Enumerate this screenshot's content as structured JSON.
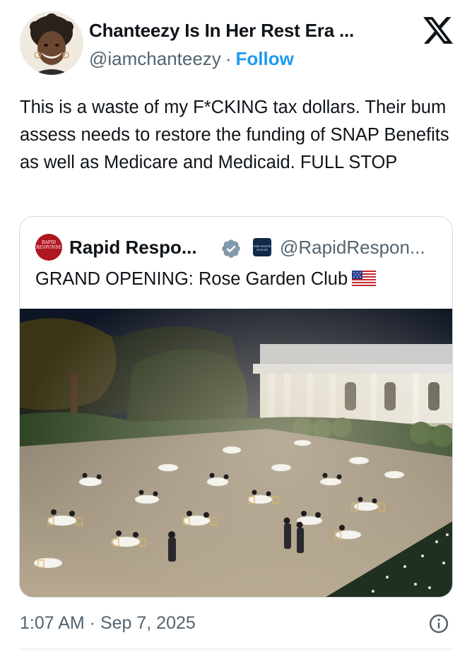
{
  "author": {
    "name": "Chanteezy Is In Her Rest Era ...",
    "handle": "@iamchanteezy",
    "separator": "·",
    "follow_label": "Follow",
    "avatar_icon": "user-avatar-photo"
  },
  "brand_icon": "x-logo-icon",
  "tweet": {
    "text": "This is a waste of my F*CKING tax dollars. Their bum assess needs to restore the funding of SNAP Benefits as well as Medicare and Medicaid. FULL STOP"
  },
  "quoted": {
    "name": "Rapid Respo...",
    "avatar_text": "RAPID RESPONSE",
    "verified_icon": "verified-badge-icon",
    "affiliate_badge_text": "THE WHITE HOUSE",
    "handle": "@RapidRespon...",
    "text": "GRAND OPENING: Rose Garden Club",
    "flag_icon": "us-flag-icon",
    "image_icon": "rose-garden-dinner-photo"
  },
  "footer": {
    "timestamp": "1:07 AM · Sep 7, 2025",
    "info_icon": "info-icon"
  },
  "colors": {
    "text": "#0f1419",
    "muted": "#536471",
    "link": "#1d9bf0",
    "border": "#cfd9de",
    "verified": "#829aab"
  }
}
